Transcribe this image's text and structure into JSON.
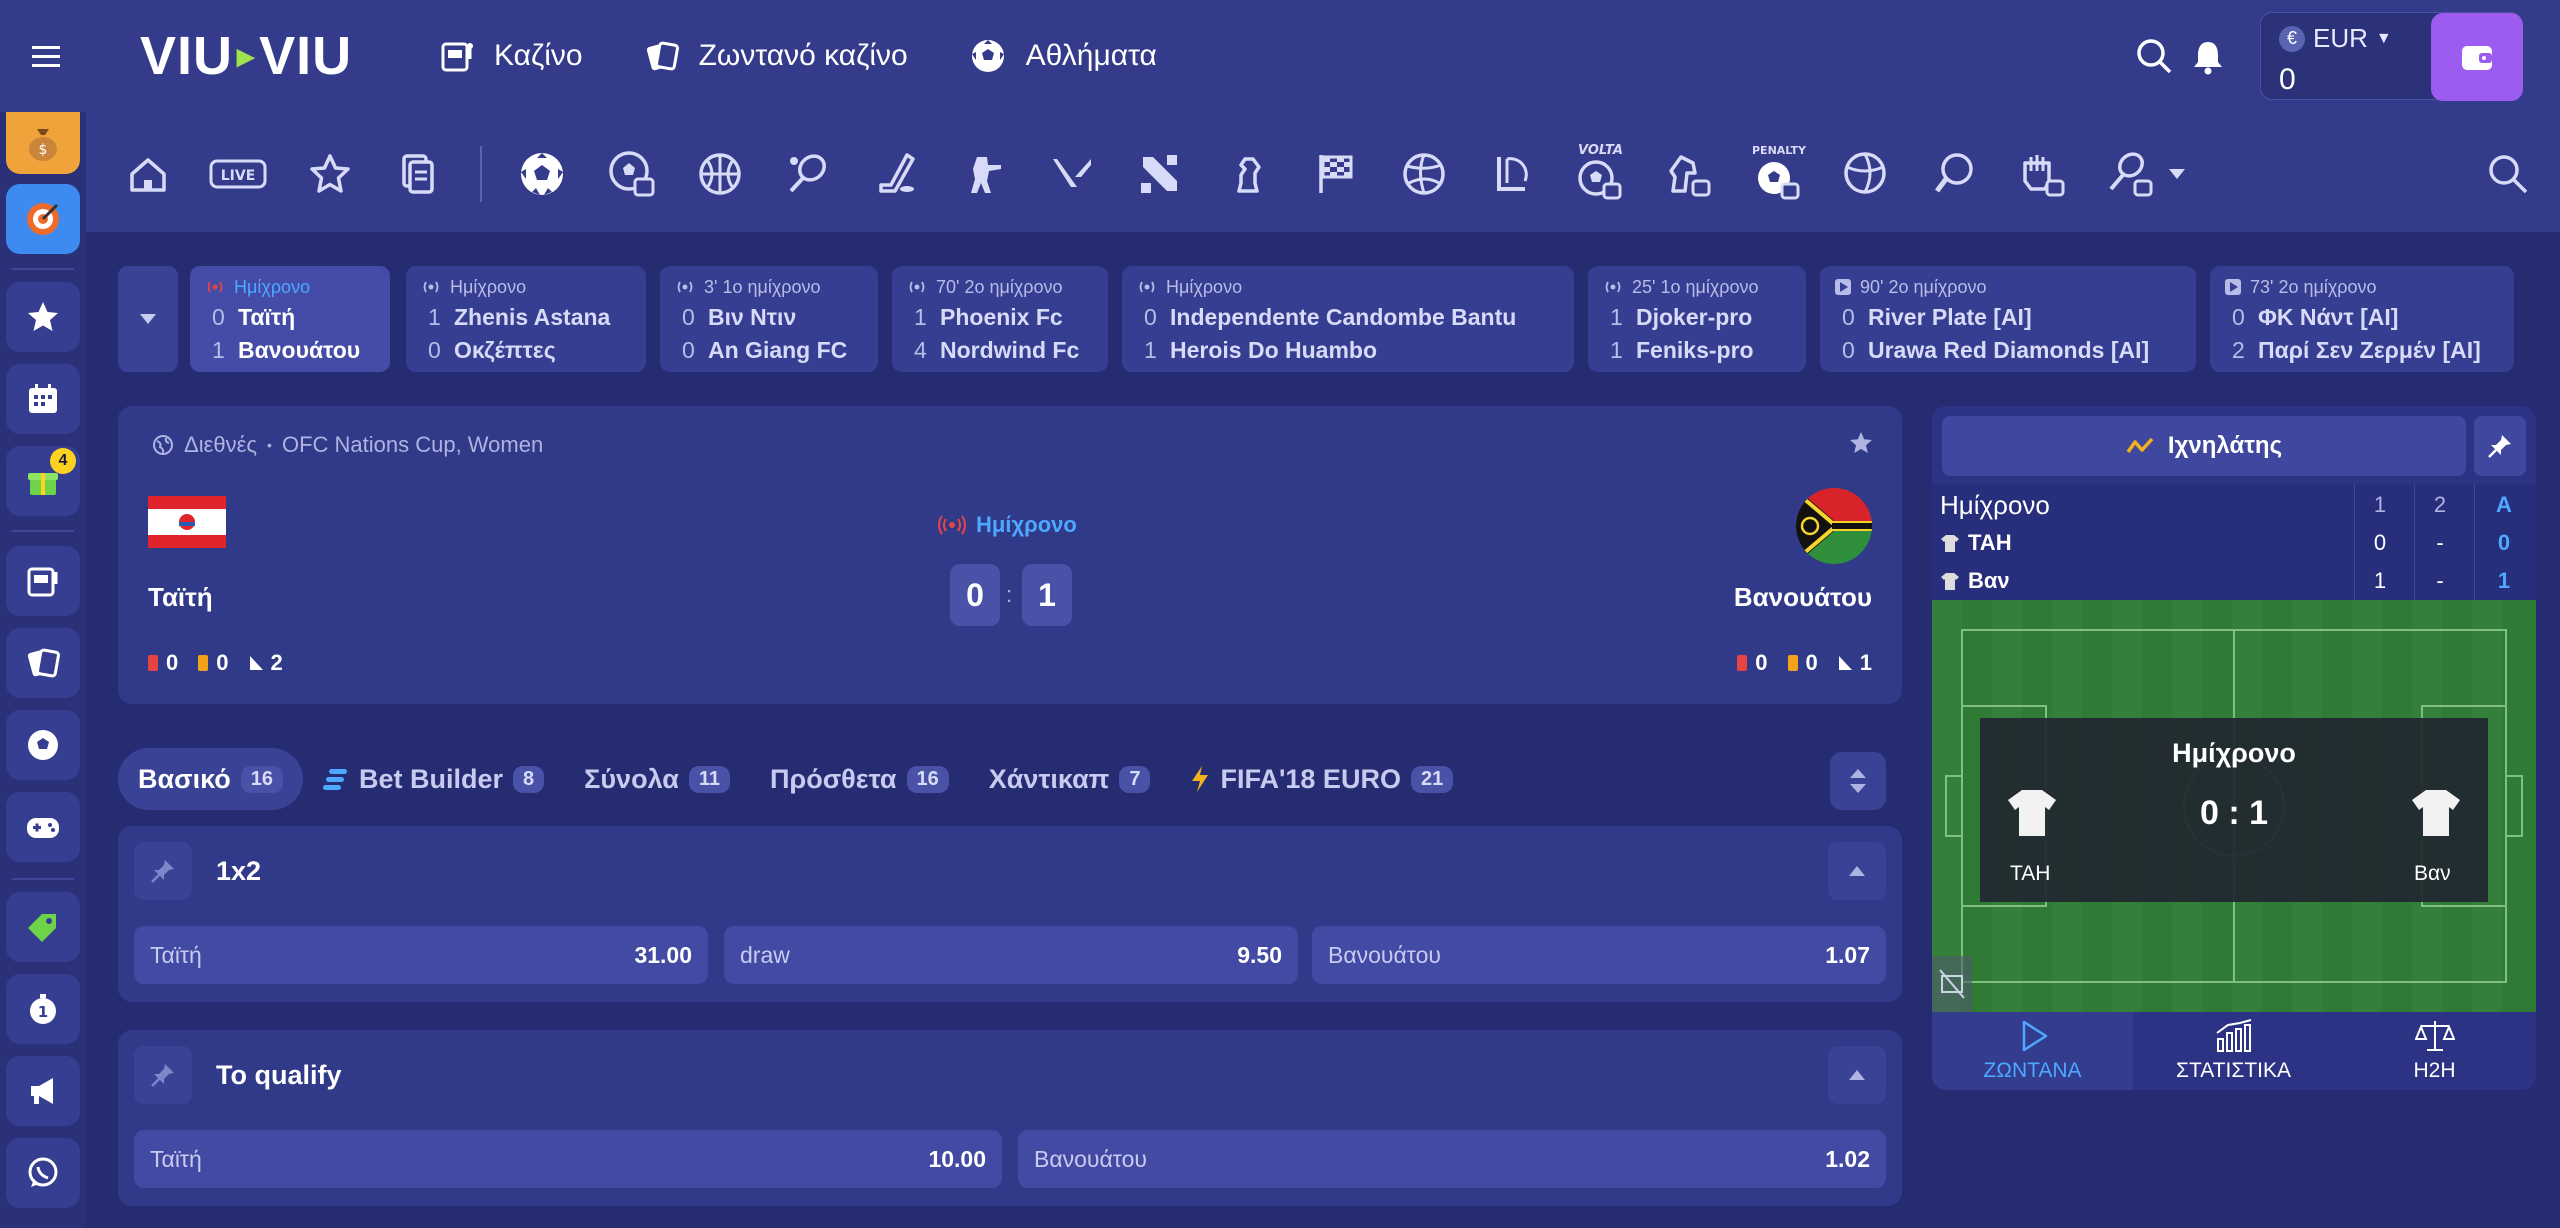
{
  "header": {
    "logo_left": "VIU",
    "logo_right": "VIU",
    "nav": [
      {
        "label": "Καζίνο",
        "icon": "slot-machine-icon"
      },
      {
        "label": "Ζωντανό καζίνο",
        "icon": "cards-icon"
      },
      {
        "label": "Αθλήματα",
        "icon": "soccer-ball-icon"
      }
    ],
    "currency": "EUR",
    "currency_symbol": "€",
    "balance": "0"
  },
  "rail": {
    "gift_badge_count": "4"
  },
  "live_strip": [
    {
      "status": "Ημίχρονο",
      "live": true,
      "active": true,
      "home_score": "0",
      "home": "Ταϊτή",
      "away_score": "1",
      "away": "Βανουάτου"
    },
    {
      "status": "Ημίχρονο",
      "live": false,
      "active": false,
      "home_score": "1",
      "home": "Zhenis Astana",
      "away_score": "0",
      "away": "Οκζέπτες"
    },
    {
      "status": "3' 1ο ημίχρονο",
      "live": false,
      "active": false,
      "home_score": "0",
      "home": "Βιν Ντιν",
      "away_score": "0",
      "away": "An Giang FC"
    },
    {
      "status": "70' 2ο ημίχρονο",
      "live": false,
      "active": false,
      "home_score": "1",
      "home": "Phoenix Fc",
      "away_score": "4",
      "away": "Nordwind Fc"
    },
    {
      "status": "Ημίχρονο",
      "live": false,
      "active": false,
      "home_score": "0",
      "home": "Independente Candombe Bantu",
      "away_score": "1",
      "away": "Herois Do Huambo"
    },
    {
      "status": "25' 1ο ημίχρονο",
      "live": false,
      "active": false,
      "home_score": "1",
      "home": "Djoker-pro",
      "away_score": "1",
      "away": "Feniks-pro"
    },
    {
      "status": "90' 2ο ημίχρονο",
      "live": false,
      "active": false,
      "home_score": "0",
      "home": "River Plate [AI]",
      "away_score": "0",
      "away": "Urawa Red Diamonds [AI]"
    },
    {
      "status": "73' 2ο ημίχρονο",
      "live": false,
      "active": false,
      "home_score": "0",
      "home": "ΦΚ Νάντ [AI]",
      "away_score": "2",
      "away": "Παρί Σεν Ζερμέν [AI]"
    }
  ],
  "match": {
    "region": "Διεθνές",
    "league": "OFC Nations Cup, Women",
    "separator": "•",
    "status": "Ημίχρονο",
    "home": "Ταϊτή",
    "away": "Βανουάτου",
    "home_score": "0",
    "away_score": "1",
    "score_sep": ":",
    "home_stats": {
      "red": "0",
      "yellow": "0",
      "corners": "2"
    },
    "away_stats": {
      "red": "0",
      "yellow": "0",
      "corners": "1"
    }
  },
  "market_tabs": [
    {
      "label": "Βασικό",
      "count": "16",
      "active": true,
      "icon": ""
    },
    {
      "label": "Bet Builder",
      "count": "8",
      "active": false,
      "icon": "bet-builder-icon"
    },
    {
      "label": "Σύνολα",
      "count": "11",
      "active": false,
      "icon": ""
    },
    {
      "label": "Πρόσθετα",
      "count": "16",
      "active": false,
      "icon": ""
    },
    {
      "label": "Χάντικαπ",
      "count": "7",
      "active": false,
      "icon": ""
    },
    {
      "label": "FIFA'18 EURO",
      "count": "21",
      "active": false,
      "icon": "lightning-icon"
    }
  ],
  "markets": [
    {
      "title": "1x2",
      "odds": [
        {
          "label": "Ταϊτή",
          "value": "31.00"
        },
        {
          "label": "draw",
          "value": "9.50"
        },
        {
          "label": "Βανουάτου",
          "value": "1.07"
        }
      ]
    },
    {
      "title": "To qualify",
      "odds": [
        {
          "label": "Ταϊτή",
          "value": "10.00"
        },
        {
          "label": "Βανουάτου",
          "value": "1.02"
        }
      ]
    }
  ],
  "tracker": {
    "button": "Ιχνηλάτης",
    "table_header": {
      "label": "Ημίχρονο",
      "c1": "1",
      "c2": "2",
      "c3": "A"
    },
    "rows": [
      {
        "team": "ΤΑΗ",
        "c1": "0",
        "c2": "-",
        "c3": "0"
      },
      {
        "team": "Βαν",
        "c1": "1",
        "c2": "-",
        "c3": "1"
      }
    ],
    "overlay_title": "Ημίχρονο",
    "overlay_score": "0 : 1",
    "overlay_home": "ΤΑΗ",
    "overlay_away": "Βαν",
    "tabs": [
      {
        "label": "ΖΩΝΤΑΝΑ",
        "active": true
      },
      {
        "label": "ΣΤΑΤΙΣΤΙΚΑ",
        "active": false
      },
      {
        "label": "H2H",
        "active": false
      }
    ]
  },
  "colors": {
    "background": "#262c72",
    "panel": "#313989",
    "accent_blue": "#4da8ff",
    "wallet_purple": "#9c5cf0",
    "logo_green": "#9fe24d"
  }
}
